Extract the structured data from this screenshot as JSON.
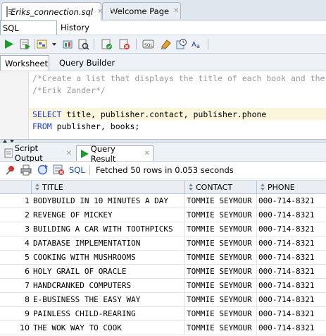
{
  "editor_tabs": [
    {
      "label": "Eriks_connection.sql",
      "icon": "sql-file-icon",
      "active": true
    },
    {
      "label": "Welcome Page",
      "icon": "oracle-icon",
      "active": false
    }
  ],
  "sub_tabs": [
    "SQL Worksheet",
    "History"
  ],
  "worksheet_tabs": [
    "Worksheet",
    "Query Builder"
  ],
  "toolbar_icons": [
    "run-statement-icon",
    "run-script-icon",
    "explain-plan-icon",
    "dropdown-icon",
    "autotrace-icon",
    "sql-tuning-icon",
    "commit-icon",
    "rollback-icon",
    "unshared-sql-icon",
    "clear-icon",
    "history-icon",
    "format-case-icon"
  ],
  "editor_lines": [
    {
      "parts": [
        {
          "t": "/*Create a list that displays the title of each book and the",
          "c": "comment"
        }
      ]
    },
    {
      "parts": [
        {
          "t": "/*Erik Zander*/",
          "c": "comment"
        }
      ]
    },
    {
      "parts": [
        {
          "t": "",
          "c": ""
        }
      ]
    },
    {
      "parts": [
        {
          "t": "SELECT",
          "c": "kw"
        },
        {
          "t": " title, publisher.contact, publisher.phone",
          "c": ""
        }
      ]
    },
    {
      "parts": [
        {
          "t": "FROM",
          "c": "kw"
        },
        {
          "t": " publisher, books;",
          "c": ""
        }
      ]
    }
  ],
  "result_tabs": [
    "Script Output",
    "Query Result"
  ],
  "result_toolbar": {
    "sql_label": "SQL",
    "status": "Fetched 50 rows in 0.053 seconds"
  },
  "columns": [
    "TITLE",
    "CONTACT",
    "PHONE"
  ],
  "rows": [
    {
      "n": "1",
      "title": "BODYBUILD IN 10 MINUTES A DAY",
      "contact": "TOMMIE SEYMOUR",
      "phone": "000-714-8321"
    },
    {
      "n": "2",
      "title": "REVENGE OF MICKEY",
      "contact": "TOMMIE SEYMOUR",
      "phone": "000-714-8321"
    },
    {
      "n": "3",
      "title": "BUILDING A CAR WITH TOOTHPICKS",
      "contact": "TOMMIE SEYMOUR",
      "phone": "000-714-8321"
    },
    {
      "n": "4",
      "title": "DATABASE IMPLEMENTATION",
      "contact": "TOMMIE SEYMOUR",
      "phone": "000-714-8321"
    },
    {
      "n": "5",
      "title": "COOKING WITH MUSHROOMS",
      "contact": "TOMMIE SEYMOUR",
      "phone": "000-714-8321"
    },
    {
      "n": "6",
      "title": "HOLY GRAIL OF ORACLE",
      "contact": "TOMMIE SEYMOUR",
      "phone": "000-714-8321"
    },
    {
      "n": "7",
      "title": "HANDCRANKED COMPUTERS",
      "contact": "TOMMIE SEYMOUR",
      "phone": "000-714-8321"
    },
    {
      "n": "8",
      "title": "E-BUSINESS THE EASY WAY",
      "contact": "TOMMIE SEYMOUR",
      "phone": "000-714-8321"
    },
    {
      "n": "9",
      "title": "PAINLESS CHILD-REARING",
      "contact": "TOMMIE SEYMOUR",
      "phone": "000-714-8321"
    },
    {
      "n": "10",
      "title": "THE WOK WAY TO COOK",
      "contact": "TOMMIE SEYMOUR",
      "phone": "000-714-8321"
    }
  ],
  "colors": {
    "keyword": "#1d3bd8",
    "comment": "#9a9a9a",
    "current_line": "#fbf5dc",
    "run_green": "#1e9b2f"
  }
}
